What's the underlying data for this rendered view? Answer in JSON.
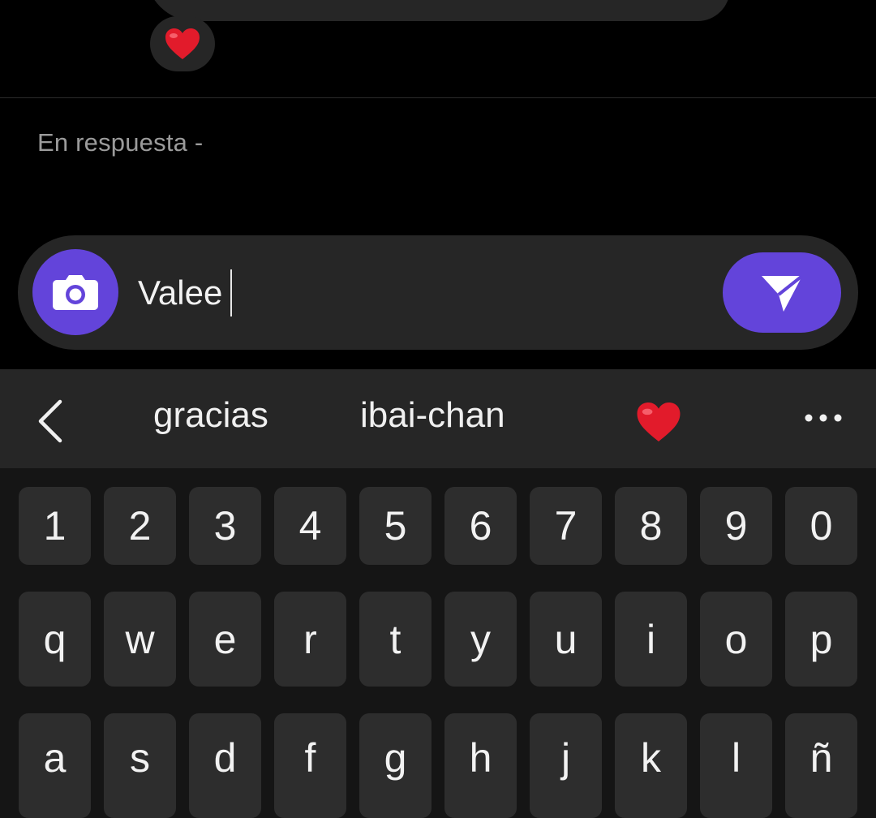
{
  "message": {
    "reaction_icon": "red-heart"
  },
  "reply": {
    "label": "En respuesta -"
  },
  "composer": {
    "camera_icon": "camera-icon",
    "input_value": "Valee",
    "send_icon": "send-icon",
    "accent_color": "#6344da"
  },
  "keyboard": {
    "suggestions": [
      "gracias",
      "ibai-chan"
    ],
    "suggestion_emoji": "red-heart",
    "number_row": [
      "1",
      "2",
      "3",
      "4",
      "5",
      "6",
      "7",
      "8",
      "9",
      "0"
    ],
    "letter_row_1": [
      "q",
      "w",
      "e",
      "r",
      "t",
      "y",
      "u",
      "i",
      "o",
      "p"
    ],
    "letter_row_2": [
      "a",
      "s",
      "d",
      "f",
      "g",
      "h",
      "j",
      "k",
      "l",
      "ñ"
    ]
  }
}
